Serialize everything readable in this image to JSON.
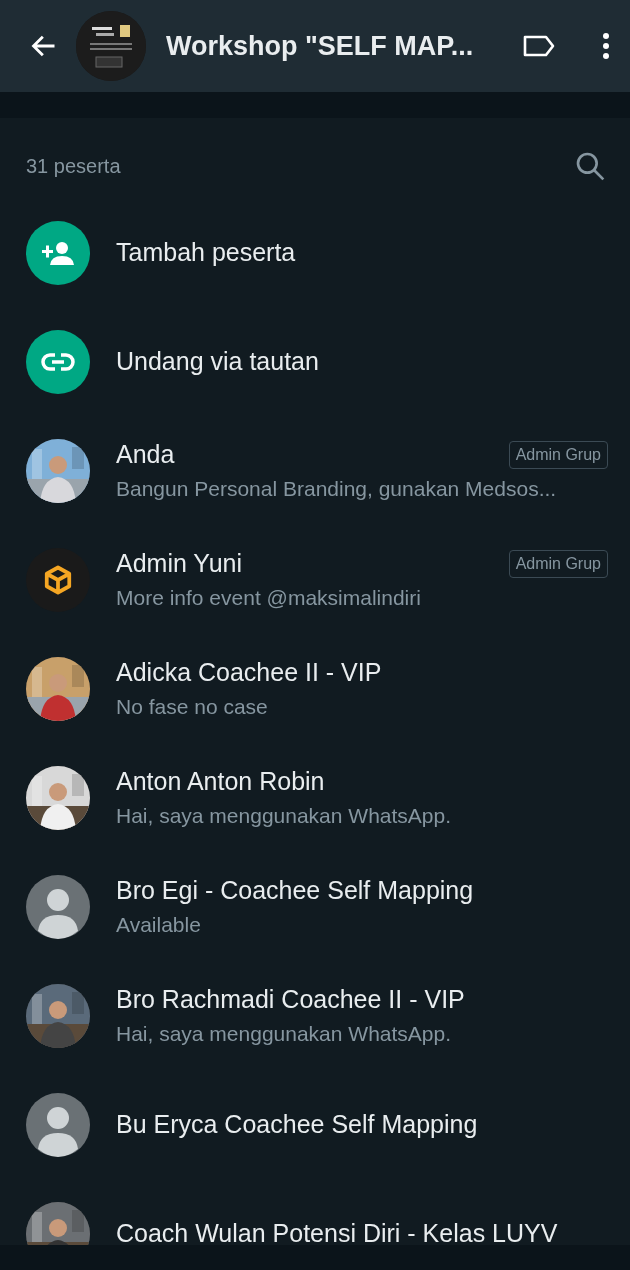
{
  "header": {
    "title": "Workshop \"SELF MAP..."
  },
  "participants": {
    "count": "31 peserta"
  },
  "actions": [
    {
      "kind": "add",
      "label": "Tambah peserta"
    },
    {
      "kind": "link",
      "label": "Undang via tautan"
    }
  ],
  "members": [
    {
      "name": "Anda",
      "status": "Bangun Personal Branding, gunakan Medsos...",
      "badge": "Admin Grup"
    },
    {
      "kind": "logo",
      "name": "Admin Yuni",
      "status": "More info event @maksimalindiri",
      "badge": "Admin Grup"
    },
    {
      "name": "Adicka Coachee II - VIP",
      "status": "No fase no case"
    },
    {
      "name": "Anton Anton Robin",
      "status": "Hai, saya menggunakan WhatsApp."
    },
    {
      "kind": "default",
      "name": "Bro Egi - Coachee Self Mapping",
      "status": "Available"
    },
    {
      "name": "Bro Rachmadi Coachee II - VIP",
      "status": "Hai, saya menggunakan WhatsApp."
    },
    {
      "kind": "default",
      "name": "Bu Eryca Coachee Self Mapping"
    },
    {
      "name": "Coach Wulan Potensi Diri - Kelas LUYV"
    }
  ]
}
